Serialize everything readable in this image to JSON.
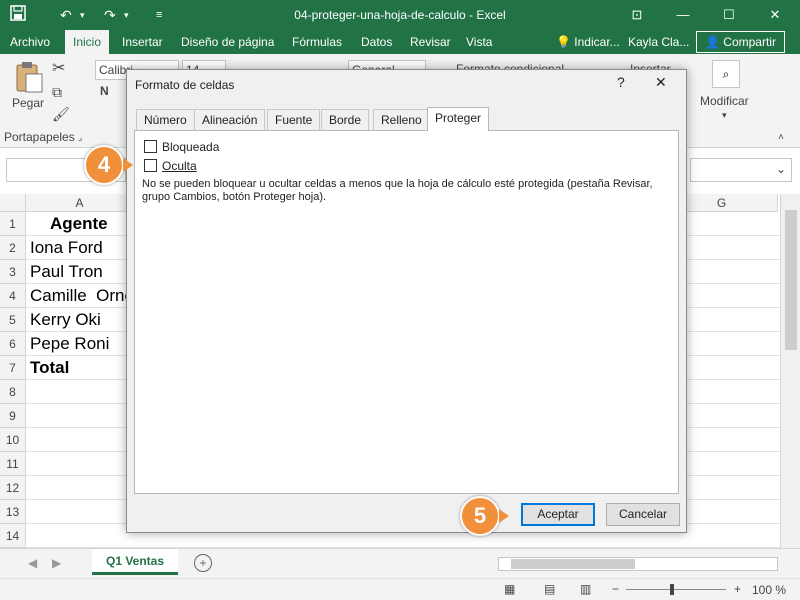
{
  "titlebar": {
    "title": "04-proteger-una-hoja-de-calculo  -  Excel",
    "save_icon": "save-icon",
    "undo_icon": "undo-icon",
    "redo_icon": "redo-icon"
  },
  "tabs": [
    "Archivo",
    "Inicio",
    "Insertar",
    "Diseño de página",
    "Fórmulas",
    "Datos",
    "Revisar",
    "Vista"
  ],
  "tell_me": "Indicar...",
  "user": "Kayla Cla...",
  "share": "Compartir",
  "ribbon": {
    "paste_label": "Pegar",
    "clipboard_label": "Portapapeles",
    "font_name": "Calibri",
    "font_size": "14",
    "bold": "N",
    "number_format": "General",
    "conditional_format": "Formato condicional",
    "insert": "Insertar",
    "modify": "Modificar"
  },
  "grid": {
    "columns": [
      "A",
      "G"
    ],
    "row_numbers": [
      "1",
      "2",
      "3",
      "4",
      "5",
      "6",
      "7",
      "8",
      "9",
      "10",
      "11",
      "12",
      "13",
      "14"
    ],
    "cells": [
      "Agente",
      "Iona Ford",
      "Paul Tron",
      "Camille  Orne",
      "Kerry Oki",
      "Pepe Roni",
      "Total"
    ]
  },
  "sheet_tab": "Q1 Ventas",
  "zoom": "100 %",
  "dialog": {
    "title": "Formato de celdas",
    "help": "?",
    "close": "✕",
    "tabs": [
      "Número",
      "Alineación",
      "Fuente",
      "Borde",
      "Relleno",
      "Proteger"
    ],
    "active_tab": "Proteger",
    "locked_label": "Bloqueada",
    "hidden_label": "Oculta",
    "info_text": "No se pueden bloquear u ocultar celdas a menos que la hoja de cálculo esté protegida (pestaña Revisar, grupo Cambios, botón Proteger hoja).",
    "ok": "Aceptar",
    "cancel": "Cancelar"
  },
  "callouts": [
    "4",
    "5"
  ],
  "colors": {
    "excel_green": "#217346",
    "callout_orange": "#f0903a"
  }
}
